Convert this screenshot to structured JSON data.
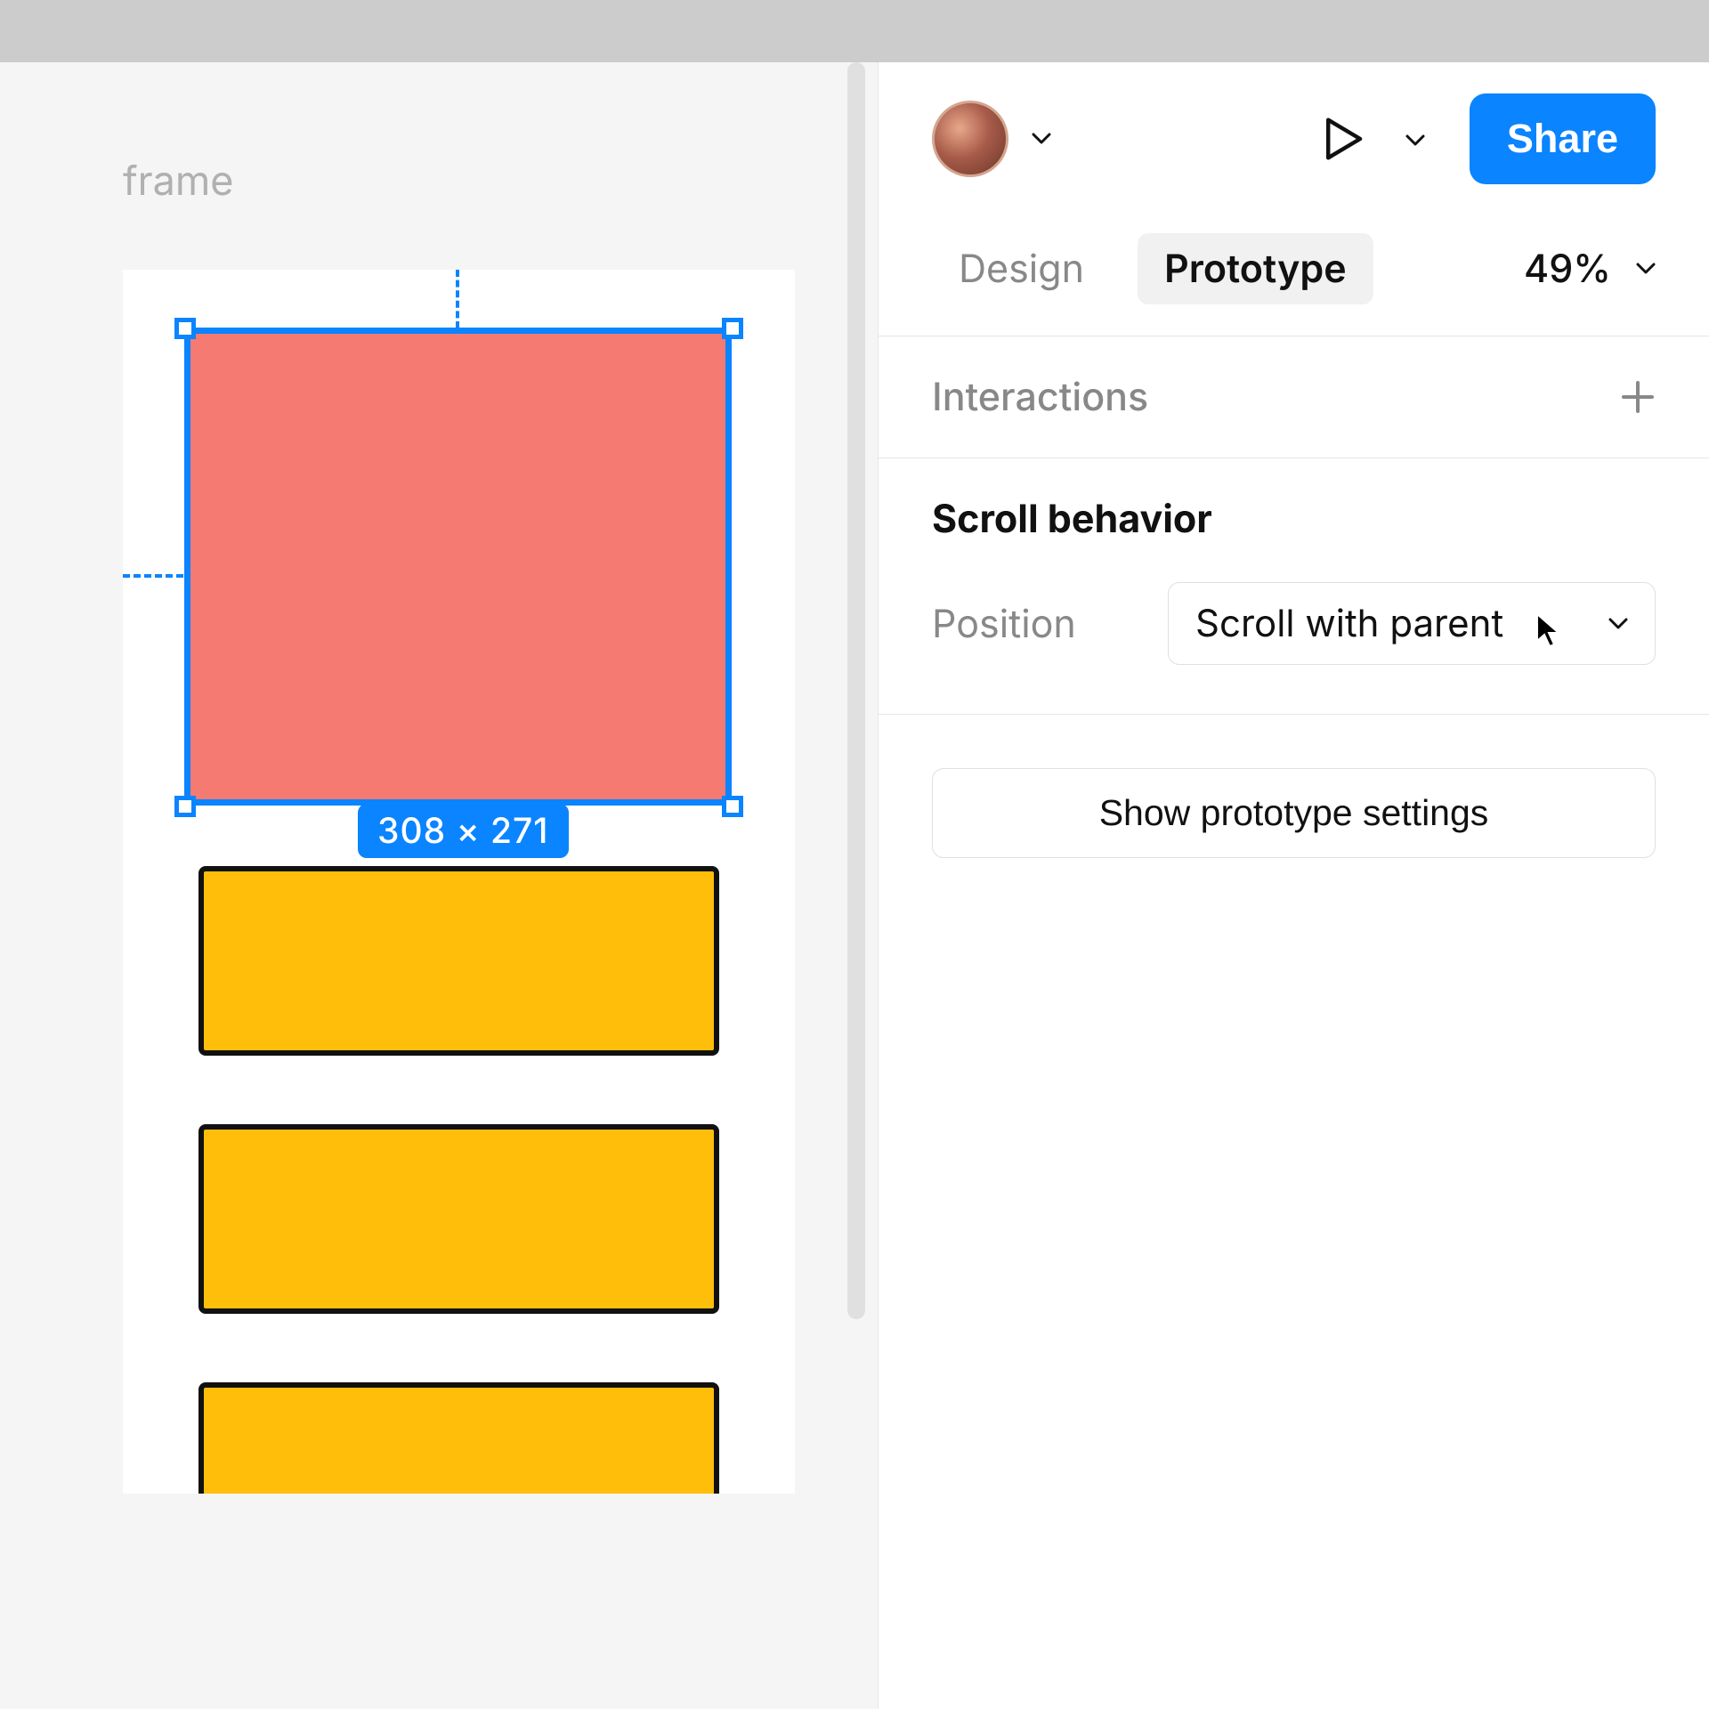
{
  "canvas": {
    "frame_label": "frame",
    "selection_dim": "308 × 271"
  },
  "top": {
    "share_label": "Share"
  },
  "tabs": {
    "design": "Design",
    "prototype": "Prototype",
    "zoom": "49%"
  },
  "interactions": {
    "title": "Interactions"
  },
  "scroll": {
    "title": "Scroll behavior",
    "position_label": "Position",
    "position_value": "Scroll with parent"
  },
  "proto_settings_label": "Show prototype settings"
}
